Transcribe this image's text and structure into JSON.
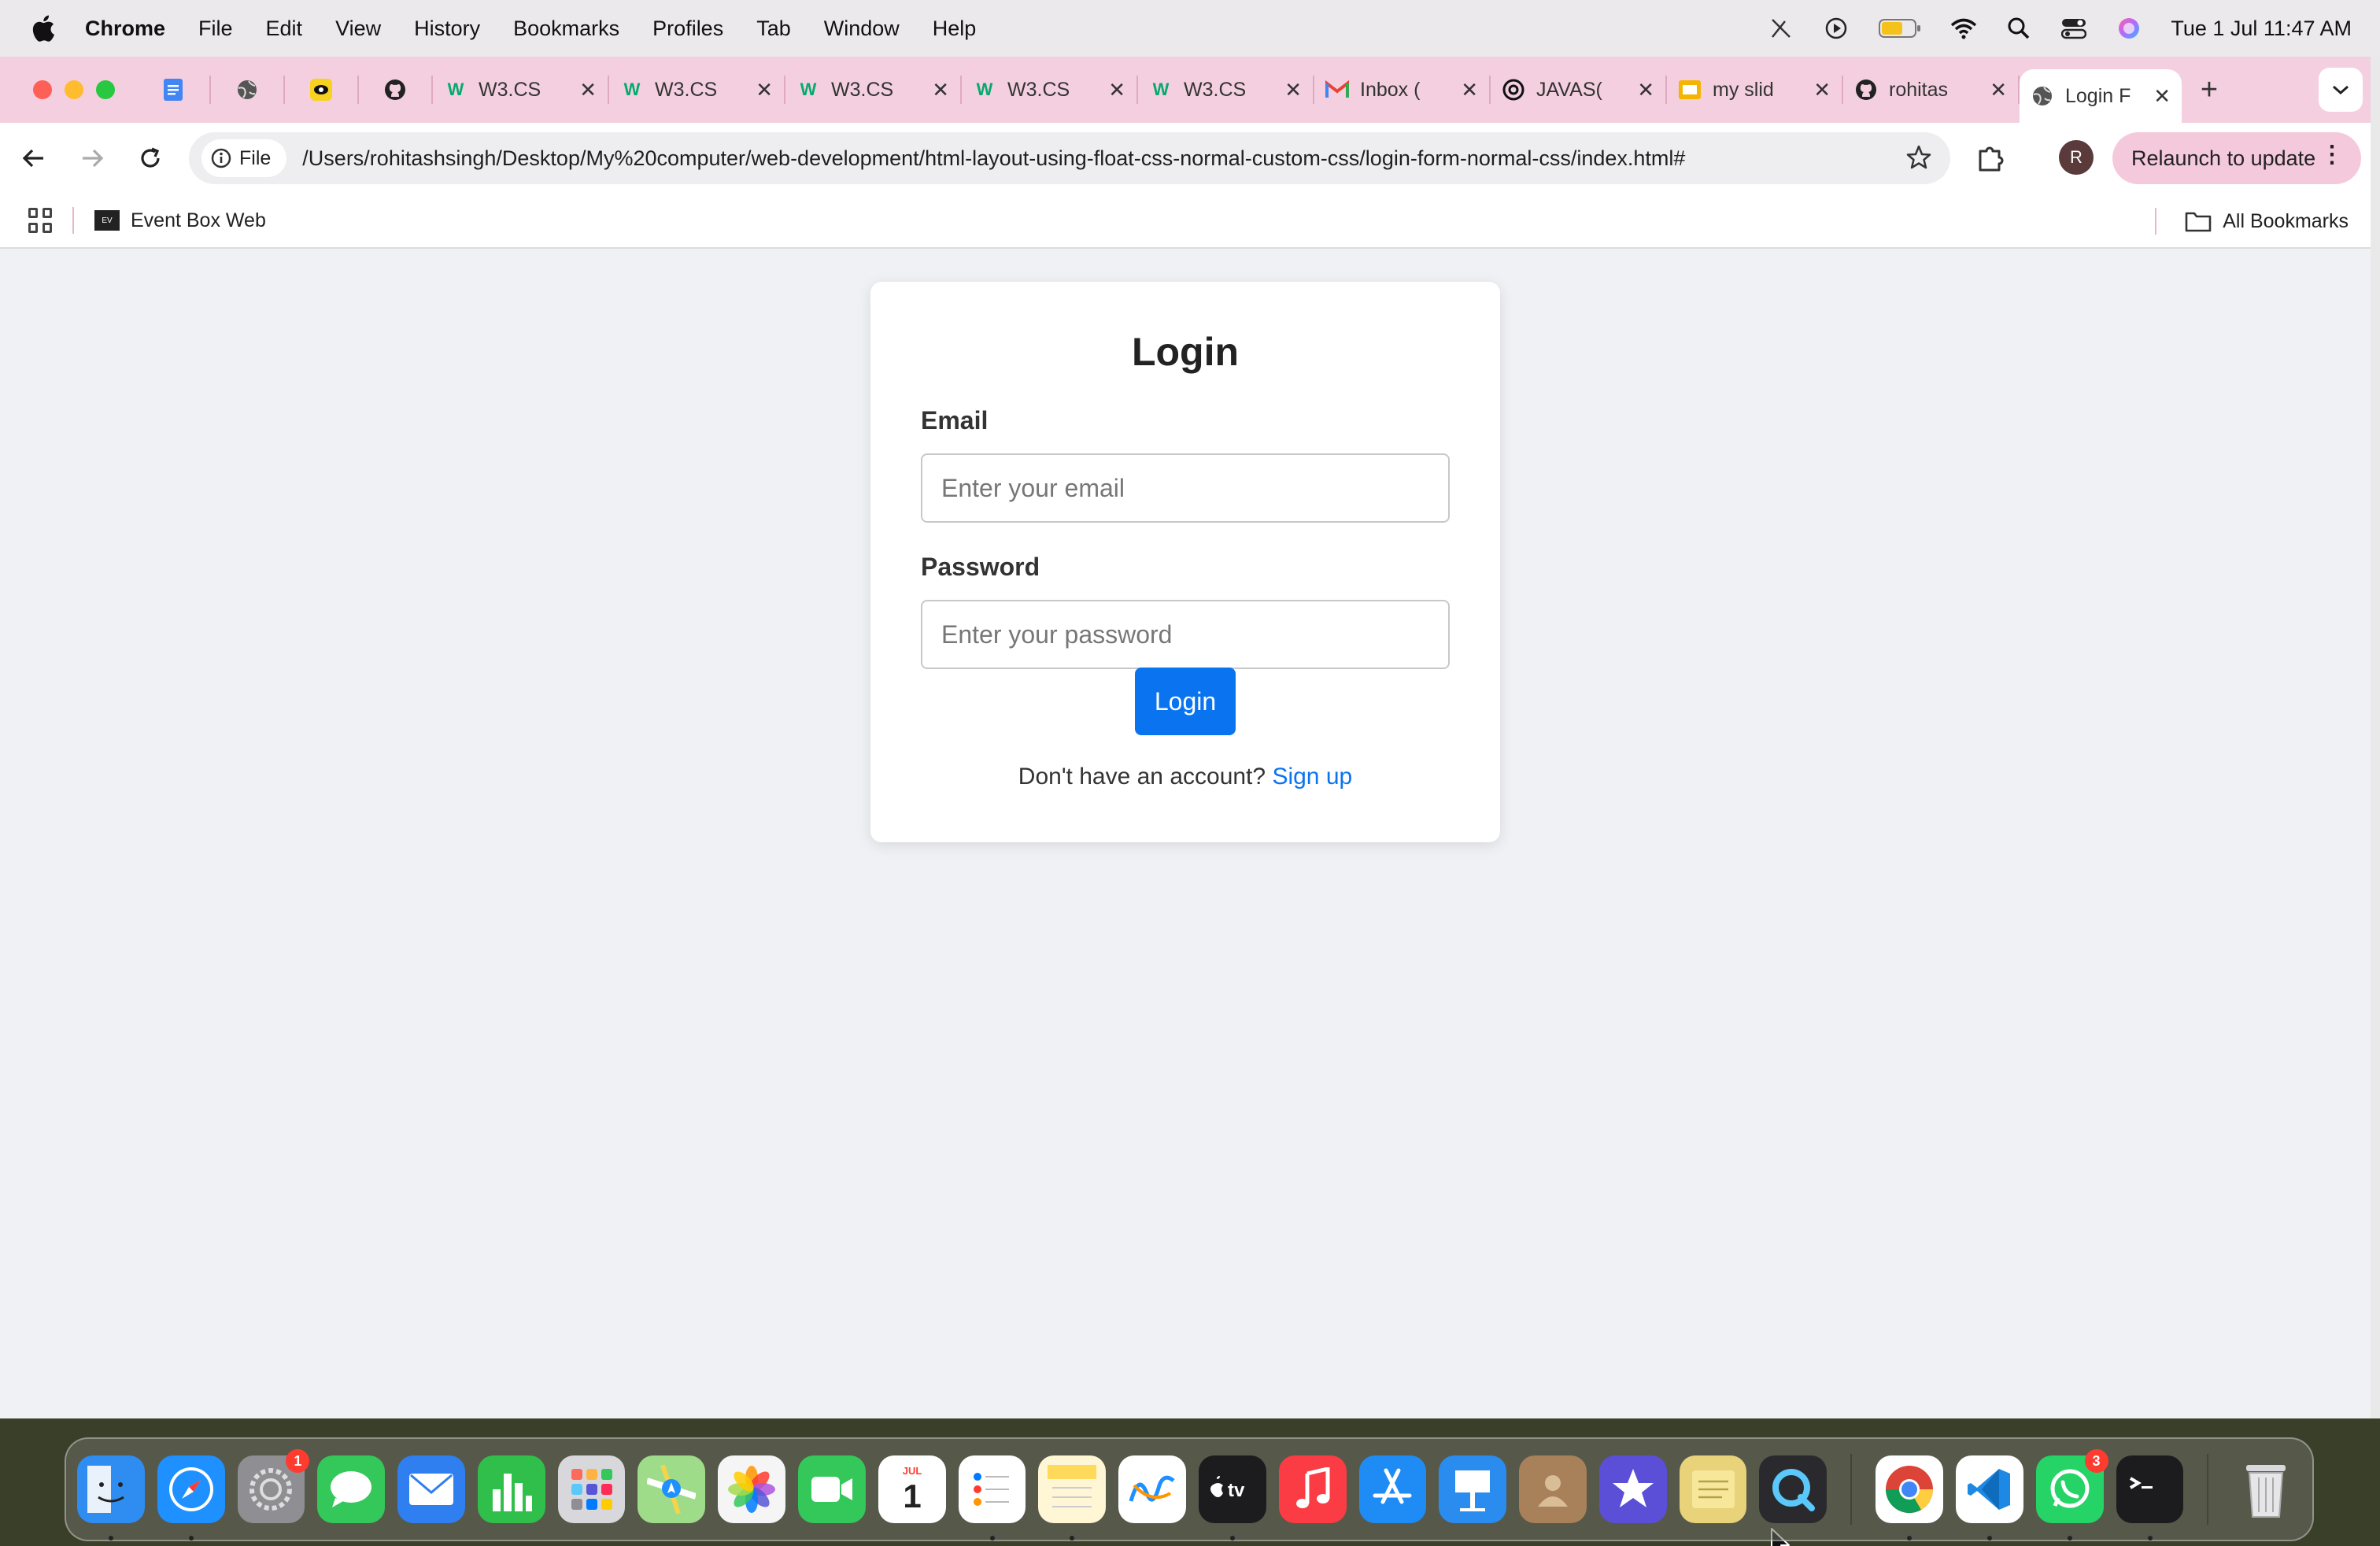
{
  "menubar": {
    "app_name": "Chrome",
    "items": [
      "File",
      "Edit",
      "View",
      "History",
      "Bookmarks",
      "Profiles",
      "Tab",
      "Window",
      "Help"
    ],
    "clock": "Tue 1 Jul  11:47 AM"
  },
  "browser": {
    "tabs": [
      {
        "icon": "docs-icon",
        "pinned": true
      },
      {
        "icon": "globe-icon",
        "pinned": true
      },
      {
        "icon": "emoji-icon",
        "pinned": true
      },
      {
        "icon": "github-icon",
        "pinned": true
      },
      {
        "icon": "w3schools-icon",
        "title": "W3.CS"
      },
      {
        "icon": "w3schools-icon",
        "title": "W3.CS"
      },
      {
        "icon": "w3schools-icon",
        "title": "W3.CS"
      },
      {
        "icon": "w3schools-icon",
        "title": "W3.CS"
      },
      {
        "icon": "w3schools-icon",
        "title": "W3.CS"
      },
      {
        "icon": "gmail-icon",
        "title": "Inbox ("
      },
      {
        "icon": "openai-icon",
        "title": "JAVAS("
      },
      {
        "icon": "slides-icon",
        "title": "my slid"
      },
      {
        "icon": "github-icon",
        "title": "rohitas"
      },
      {
        "icon": "globe-icon",
        "title": "Login F",
        "active": true
      }
    ],
    "omnibox": {
      "chip_label": "File",
      "url": "/Users/rohitashsingh/Desktop/My%20computer/web-development/html-layout-using-float-css-normal-custom-css/login-form-normal-css/index.html#"
    },
    "avatar_letter": "R",
    "relaunch_label": "Relaunch to update",
    "bookmarks": {
      "items": [
        {
          "label": "Event Box Web",
          "icon": "eventbox-icon"
        }
      ],
      "all_label": "All Bookmarks"
    }
  },
  "login": {
    "title": "Login",
    "email_label": "Email",
    "email_placeholder": "Enter your email",
    "password_label": "Password",
    "password_placeholder": "Enter your password",
    "button_label": "Login",
    "signup_prompt": "Don't have an account?",
    "signup_link": "Sign up"
  },
  "dock": {
    "apps": [
      {
        "name": "Finder",
        "color": "#2f8cf0"
      },
      {
        "name": "Safari",
        "color": "#1e90ff"
      },
      {
        "name": "System Settings",
        "color": "#8e8e93",
        "badge": "1"
      },
      {
        "name": "Messages",
        "color": "#34c759"
      },
      {
        "name": "Mail",
        "color": "#2f7ff0"
      },
      {
        "name": "Numbers",
        "color": "#2fbf4a"
      },
      {
        "name": "Launchpad",
        "color": "#d8d8dc"
      },
      {
        "name": "Maps",
        "color": "#5ac8fa"
      },
      {
        "name": "Photos",
        "color": "#f5f5f5"
      },
      {
        "name": "FaceTime",
        "color": "#34c759"
      },
      {
        "name": "Calendar",
        "color": "#ffffff"
      },
      {
        "name": "Reminders",
        "color": "#ffffff"
      },
      {
        "name": "Notes",
        "color": "#ffd95a"
      },
      {
        "name": "Freeform",
        "color": "#ffffff"
      },
      {
        "name": "TV",
        "color": "#1c1c1e"
      },
      {
        "name": "Music",
        "color": "#fc3c44"
      },
      {
        "name": "App Store",
        "color": "#1f8cf5"
      },
      {
        "name": "Keynote",
        "color": "#2b8cf0"
      },
      {
        "name": "Contacts",
        "color": "#a8805a"
      },
      {
        "name": "iMovie",
        "color": "#5b4fd8"
      },
      {
        "name": "Stickies",
        "color": "#e8d27a"
      },
      {
        "name": "QuickTime Player",
        "color": "#2a2a2e"
      },
      {
        "name": "Google Chrome",
        "color": "#ffffff"
      },
      {
        "name": "Visual Studio Code",
        "color": "#ffffff"
      },
      {
        "name": "WhatsApp",
        "color": "#25d366",
        "badge": "3"
      },
      {
        "name": "Terminal",
        "color": "#1c1c1e"
      },
      {
        "name": "Trash",
        "color": "#d9d9dc"
      }
    ]
  },
  "colors": {
    "accent": "#0a74f0",
    "tabstrip": "#f4cfe0",
    "page_bg": "#eff1f5"
  }
}
